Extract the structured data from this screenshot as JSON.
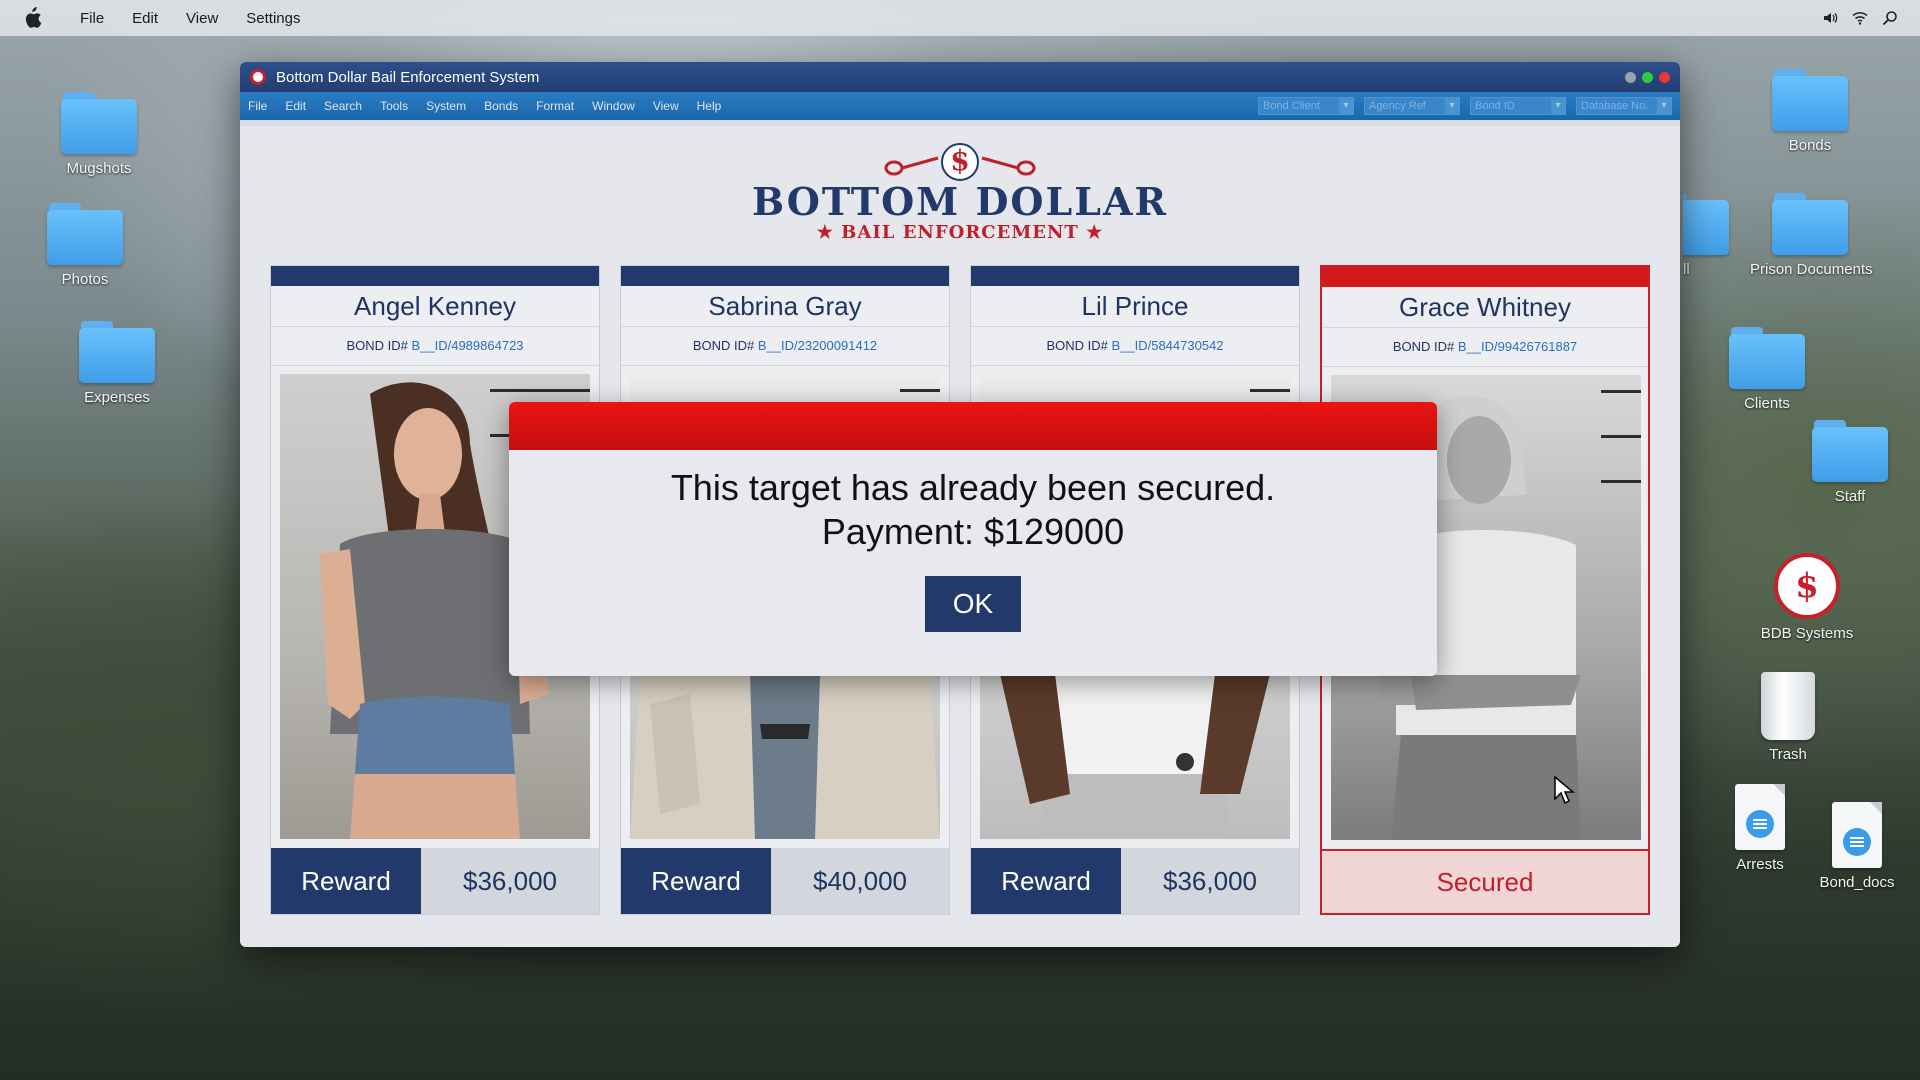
{
  "os_menubar": {
    "items": [
      "File",
      "Edit",
      "View",
      "Settings"
    ]
  },
  "desktop_icons": {
    "left": [
      {
        "label": "Mugshots",
        "type": "folder"
      },
      {
        "label": "Photos",
        "type": "folder"
      },
      {
        "label": "Expenses",
        "type": "folder"
      }
    ],
    "right": [
      {
        "label": "Bonds",
        "type": "folder"
      },
      {
        "label": "Prison Documents",
        "type": "folder"
      },
      {
        "label": "Clients",
        "type": "folder"
      },
      {
        "label": "Staff",
        "type": "folder"
      },
      {
        "label": "BDB Systems",
        "type": "app"
      },
      {
        "label": "Trash",
        "type": "trash"
      },
      {
        "label": "Arrests",
        "type": "document"
      },
      {
        "label": "Bond_docs",
        "type": "document"
      },
      {
        "label": "ll",
        "type": "folder-partial"
      }
    ]
  },
  "window": {
    "title": "Bottom Dollar Bail Enforcement System",
    "menu": [
      "File",
      "Edit",
      "Search",
      "Tools",
      "System",
      "Bonds",
      "Format",
      "Window",
      "View",
      "Help"
    ],
    "selects": [
      "Bond Client",
      "Agency Ref",
      "Bond ID",
      "Database No."
    ]
  },
  "logo": {
    "symbol": "$",
    "main": "BOTTOM DOLLAR",
    "sub": "★ BAIL ENFORCEMENT ★"
  },
  "bond_prefix": "BOND ID#",
  "cards": [
    {
      "name": "Angel Kenney",
      "bond_id": "B__ID/4989864723",
      "reward_label": "Reward",
      "reward": "$36,000",
      "status": "open"
    },
    {
      "name": "Sabrina Gray",
      "bond_id": "B__ID/23200091412",
      "reward_label": "Reward",
      "reward": "$40,000",
      "status": "open"
    },
    {
      "name": "Lil Prince",
      "bond_id": "B__ID/5844730542",
      "reward_label": "Reward",
      "reward": "$36,000",
      "status": "open"
    },
    {
      "name": "Grace Whitney",
      "bond_id": "B__ID/99426761887",
      "status_label": "Secured",
      "status": "secured"
    }
  ],
  "modal": {
    "line1": "This target has already been secured.",
    "line2": "Payment: $129000",
    "ok_label": "OK"
  },
  "colors": {
    "navy": "#223a6b",
    "alert_red": "#d21a1a",
    "menu_blue": "#1d66aa"
  }
}
